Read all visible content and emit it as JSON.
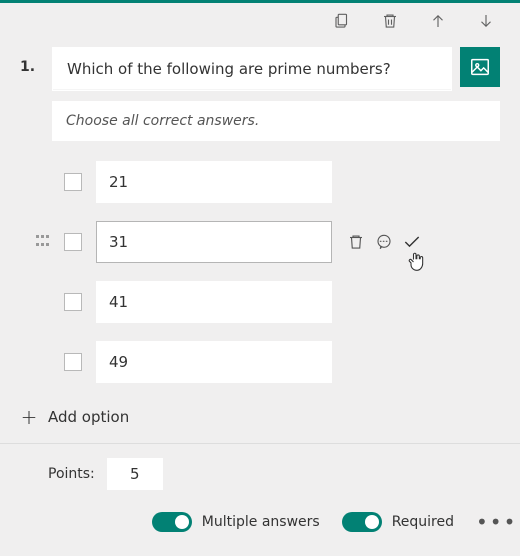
{
  "question": {
    "number": "1.",
    "text": "Which of the following are prime numbers?",
    "subtitle": "Choose all correct answers."
  },
  "options": [
    {
      "text": "21"
    },
    {
      "text": "31"
    },
    {
      "text": "41"
    },
    {
      "text": "49"
    }
  ],
  "addOptionLabel": "Add option",
  "footer": {
    "pointsLabel": "Points:",
    "pointsValue": "5",
    "multipleAnswersLabel": "Multiple answers",
    "requiredLabel": "Required"
  }
}
